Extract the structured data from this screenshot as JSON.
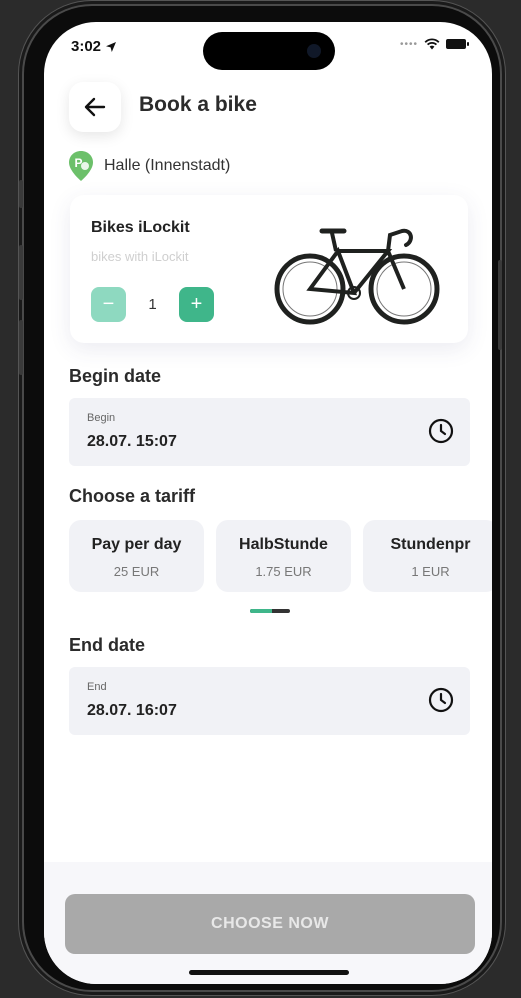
{
  "status": {
    "time": "3:02"
  },
  "header": {
    "title": "Book a bike"
  },
  "location": {
    "name": "Halle (Innenstadt)"
  },
  "bike": {
    "name": "Bikes iLockit",
    "subtitle": "bikes with iLockit",
    "quantity": "1",
    "minus": "−",
    "plus": "+"
  },
  "begin": {
    "section": "Begin date",
    "label": "Begin",
    "value": "28.07. 15:07"
  },
  "tariff": {
    "section": "Choose a tariff",
    "items": [
      {
        "name": "Pay per day",
        "price": "25 EUR"
      },
      {
        "name": "HalbStunde",
        "price": "1.75 EUR"
      },
      {
        "name": "Stundenpr",
        "price": "1 EUR"
      }
    ]
  },
  "end": {
    "section": "End date",
    "label": "End",
    "value": "28.07. 16:07"
  },
  "footer": {
    "button": "CHOOSE NOW"
  },
  "colors": {
    "accent": "#3fb68a",
    "accent_light": "#8ed9c0",
    "field_bg": "#f1f2f6",
    "disabled_button": "#a9a9a9"
  }
}
